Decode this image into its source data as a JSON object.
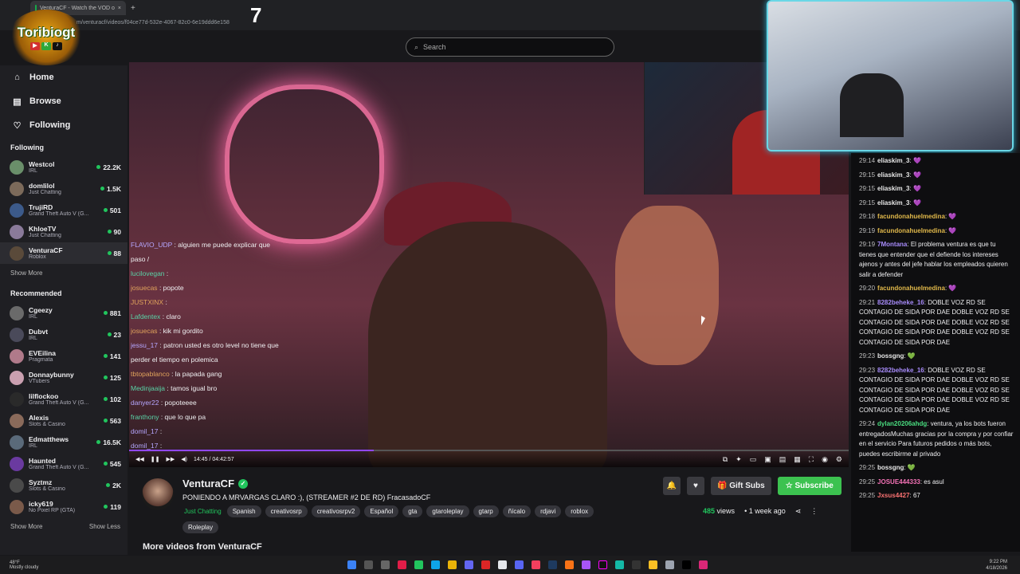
{
  "browser": {
    "tab_title": "VenturaCF - Watch the VOD o",
    "url": "m/venturacf/videos/f04ce77d-532e-4067-82c0-6e19ddd6e158"
  },
  "overlay": {
    "logo_text": "Toribiogt",
    "logo_badges": [
      "▶",
      "K",
      "♪"
    ],
    "counter": "7"
  },
  "sidebar": {
    "nav": [
      {
        "label": "Home",
        "icon": "⌂"
      },
      {
        "label": "Browse",
        "icon": "▤"
      },
      {
        "label": "Following",
        "icon": "♡"
      }
    ],
    "following_header": "Following",
    "following": [
      {
        "name": "Westcol",
        "game": "IRL",
        "viewers": "22.2K",
        "color": "#6a8f6a"
      },
      {
        "name": "domlilol",
        "game": "Just Chatting",
        "viewers": "1.5K",
        "color": "#7c6a5a"
      },
      {
        "name": "TrujiRD",
        "game": "Grand Theft Auto V (G...",
        "viewers": "501",
        "color": "#3c5a8a"
      },
      {
        "name": "KhloeTV",
        "game": "Just Chatting",
        "viewers": "90",
        "color": "#8a7a9a"
      },
      {
        "name": "VenturaCF",
        "game": "Roblox",
        "viewers": "88",
        "color": "#5a4a3a"
      }
    ],
    "show_more_1": "Show More",
    "recommended_header": "Recommended",
    "recommended": [
      {
        "name": "Cgeezy",
        "game": "IRL",
        "viewers": "881",
        "color": "#6a6a6a"
      },
      {
        "name": "Dubvt",
        "game": "IRL",
        "viewers": "23",
        "color": "#4a4a5a"
      },
      {
        "name": "EVEilina",
        "game": "Pragmata",
        "viewers": "141",
        "color": "#b07a8a"
      },
      {
        "name": "Donnaybunny",
        "game": "VTubers",
        "viewers": "125",
        "color": "#caa0b0"
      },
      {
        "name": "lilflockoo",
        "game": "Grand Theft Auto V (G...",
        "viewers": "102",
        "color": "#2a2a2a"
      },
      {
        "name": "Alexis",
        "game": "Slots & Casino",
        "viewers": "563",
        "color": "#8a6a5a"
      },
      {
        "name": "Edmatthews",
        "game": "IRL",
        "viewers": "16.5K",
        "color": "#5a6a7a"
      },
      {
        "name": "Haunted",
        "game": "Grand Theft Auto V (G...",
        "viewers": "545",
        "color": "#6a3aa0"
      },
      {
        "name": "Syztmz",
        "game": "Slots & Casino",
        "viewers": "2K",
        "color": "#4a4a4a"
      },
      {
        "name": "icky619",
        "game": "No Pixel RP (GTA)",
        "viewers": "119",
        "color": "#7a5a4a"
      }
    ],
    "show_more_2": "Show More",
    "show_less": "Show Less"
  },
  "search": {
    "placeholder": "Search"
  },
  "video_chat_overlay": [
    {
      "user": "FLAVIO_UDP",
      "text": ": alguien me puede explicar que",
      "cls": "u3"
    },
    {
      "user": "",
      "text": "paso /",
      "cls": ""
    },
    {
      "user": "lucilovegan",
      "text": ":",
      "cls": "u"
    },
    {
      "user": "josuecas",
      "text": ": popote",
      "cls": "u2"
    },
    {
      "user": "JUSTXINX",
      "text": ":",
      "cls": "u2"
    },
    {
      "user": "Lafdentex",
      "text": ": claro",
      "cls": "u"
    },
    {
      "user": "josuecas",
      "text": ": kik mi gordito",
      "cls": "u2"
    },
    {
      "user": "jessu_17",
      "text": ": patron usted es otro level no tiene que",
      "cls": "u3"
    },
    {
      "user": "",
      "text": "perder el tiempo en polemica",
      "cls": ""
    },
    {
      "user": "tbtopablanco",
      "text": ": la papada gang",
      "cls": "u2"
    },
    {
      "user": "Medinjaaija",
      "text": ": tamos igual bro",
      "cls": "u"
    },
    {
      "user": "danyer22",
      "text": ": popoteeee",
      "cls": "u3"
    },
    {
      "user": "franthony",
      "text": ": que lo que pa",
      "cls": "u"
    },
    {
      "user": "domil_17",
      "text": ":",
      "cls": "u3"
    },
    {
      "user": "domil_17",
      "text": ":",
      "cls": "u3"
    }
  ],
  "player": {
    "time": "14:45 / 04:42:57",
    "progress": 0.34
  },
  "channel": {
    "name": "VenturaCF",
    "title": "PONIENDO A MRVARGAS CLARO :), (STREAMER #2 DE RD) FracasadoCF",
    "category": "Just Chatting",
    "tags": [
      "Spanish",
      "creativosrp",
      "creativosrpv2",
      "Español",
      "gta",
      "gtaroleplay",
      "gtarp",
      "ñícalo",
      "rdjavi",
      "roblox",
      "Roleplay"
    ],
    "gift_label": "Gift Subs",
    "subscribe_label": "Subscribe",
    "views": "485",
    "views_label": "views",
    "age": "• 1 week ago",
    "more_videos": "More videos from VenturaCF"
  },
  "chat": [
    {
      "ts": "29:14",
      "name": "eliaskim_3",
      "color": "#e8e8e8",
      "text": ": 💜"
    },
    {
      "ts": "29:15",
      "name": "eliaskim_3",
      "color": "#e8e8e8",
      "text": ": 💜"
    },
    {
      "ts": "29:15",
      "name": "eliaskim_3",
      "color": "#e8e8e8",
      "text": ": 💜"
    },
    {
      "ts": "29:15",
      "name": "eliaskim_3",
      "color": "#e8e8e8",
      "text": ": 💜"
    },
    {
      "ts": "29:18",
      "name": "facundonahuelmedina",
      "color": "#e0b84a",
      "text": ": 💜"
    },
    {
      "ts": "29:19",
      "name": "facundonahuelmedina",
      "color": "#e0b84a",
      "text": ": 💜"
    },
    {
      "ts": "29:19",
      "name": "7Montana",
      "color": "#a78bfa",
      "text": ": El problema ventura es que tu tienes que entender que el defiende los intereses ajenos y antes del jefe hablar los empleados quieren salir a defender"
    },
    {
      "ts": "29:20",
      "name": "facundonahuelmedina",
      "color": "#e0b84a",
      "text": ": 💜"
    },
    {
      "ts": "29:21",
      "name": "8282beheke_16",
      "color": "#a78bfa",
      "text": ": DOBLE VOZ RD SE CONTAGIO DE SIDA POR DAE DOBLE VOZ RD SE CONTAGIO DE SIDA POR DAE DOBLE VOZ RD SE CONTAGIO DE SIDA POR DAE DOBLE VOZ RD SE CONTAGIO DE SIDA POR DAE"
    },
    {
      "ts": "29:23",
      "name": "bossgng",
      "color": "#e8e8e8",
      "text": ": 💚"
    },
    {
      "ts": "29:23",
      "name": "8282beheke_16",
      "color": "#a78bfa",
      "text": ": DOBLE VOZ RD SE CONTAGIO DE SIDA POR DAE DOBLE VOZ RD SE CONTAGIO DE SIDA POR DAE DOBLE VOZ RD SE CONTAGIO DE SIDA POR DAE DOBLE VOZ RD SE CONTAGIO DE SIDA POR DAE"
    },
    {
      "ts": "29:24",
      "name": "dylan20206ahdg",
      "color": "#4ade80",
      "text": ": ventura, ya los bots fueron entregadosMuchas gracias por la compra y por confiar en el servicio Para futuros pedidos o más bots, puedes escribirme al privado"
    },
    {
      "ts": "29:25",
      "name": "bossgng",
      "color": "#e8e8e8",
      "text": ": 💚"
    },
    {
      "ts": "29:25",
      "name": "JOSUE444333",
      "color": "#f472b6",
      "text": ": es asul"
    },
    {
      "ts": "29:25",
      "name": "Jxsus4427",
      "color": "#f87171",
      "text": ": 67"
    }
  ],
  "taskbar": {
    "weather_temp": "48°F",
    "weather_desc": "Mostly cloudy",
    "time": "9:22 PM",
    "date": "4/18/2026"
  }
}
